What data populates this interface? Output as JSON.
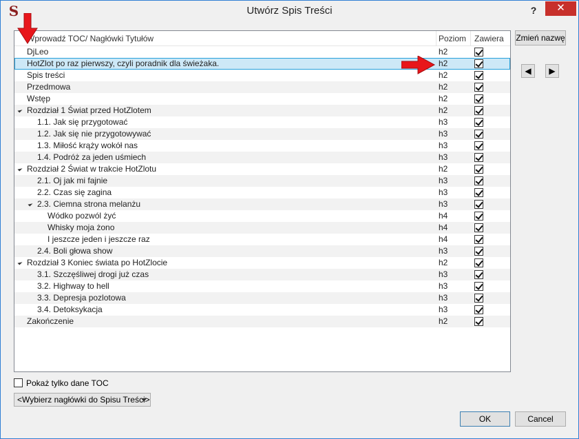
{
  "window": {
    "title": "Utwórz Spis Treści",
    "help_label": "?",
    "close_label": "✕"
  },
  "table": {
    "headers": {
      "title": "Wprowadź TOC/ Nagłówki Tytułów",
      "level": "Poziom",
      "include": "Zawiera"
    },
    "rows": [
      {
        "label": "DjLeo",
        "level": "h2",
        "checked": true,
        "indent": 0,
        "expander": false,
        "selected": false
      },
      {
        "label": "HotZlot po raz pierwszy, czyli poradnik dla świeżaka.",
        "level": "h2",
        "checked": true,
        "indent": 0,
        "expander": false,
        "selected": true
      },
      {
        "label": "Spis treści",
        "level": "h2",
        "checked": true,
        "indent": 0,
        "expander": false,
        "selected": false
      },
      {
        "label": "Przedmowa",
        "level": "h2",
        "checked": true,
        "indent": 0,
        "expander": false,
        "selected": false
      },
      {
        "label": "Wstęp",
        "level": "h2",
        "checked": true,
        "indent": 0,
        "expander": false,
        "selected": false
      },
      {
        "label": "Rozdział 1 Świat przed HotZlotem",
        "level": "h2",
        "checked": true,
        "indent": 0,
        "expander": true,
        "selected": false
      },
      {
        "label": "1.1. Jak się przygotować",
        "level": "h3",
        "checked": true,
        "indent": 1,
        "expander": false,
        "selected": false
      },
      {
        "label": "1.2. Jak się nie przygotowywać",
        "level": "h3",
        "checked": true,
        "indent": 1,
        "expander": false,
        "selected": false
      },
      {
        "label": "1.3. Miłość krąży wokół nas",
        "level": "h3",
        "checked": true,
        "indent": 1,
        "expander": false,
        "selected": false
      },
      {
        "label": "1.4. Podróż za jeden uśmiech",
        "level": "h3",
        "checked": true,
        "indent": 1,
        "expander": false,
        "selected": false
      },
      {
        "label": "Rozdział 2 Świat w trakcie HotZlotu",
        "level": "h2",
        "checked": true,
        "indent": 0,
        "expander": true,
        "selected": false
      },
      {
        "label": "2.1. Oj jak mi fajnie",
        "level": "h3",
        "checked": true,
        "indent": 1,
        "expander": false,
        "selected": false
      },
      {
        "label": "2.2. Czas się zagina",
        "level": "h3",
        "checked": true,
        "indent": 1,
        "expander": false,
        "selected": false
      },
      {
        "label": "2.3. Ciemna strona melanżu",
        "level": "h3",
        "checked": true,
        "indent": 1,
        "expander": true,
        "selected": false
      },
      {
        "label": "Wódko pozwól żyć",
        "level": "h4",
        "checked": true,
        "indent": 2,
        "expander": false,
        "selected": false
      },
      {
        "label": "Whisky moja żono",
        "level": "h4",
        "checked": true,
        "indent": 2,
        "expander": false,
        "selected": false
      },
      {
        "label": "I jeszcze jeden i jeszcze raz",
        "level": "h4",
        "checked": true,
        "indent": 2,
        "expander": false,
        "selected": false
      },
      {
        "label": "2.4. Boli głowa show",
        "level": "h3",
        "checked": true,
        "indent": 1,
        "expander": false,
        "selected": false
      },
      {
        "label": "Rozdział 3 Koniec świata po HotZlocie",
        "level": "h2",
        "checked": true,
        "indent": 0,
        "expander": true,
        "selected": false
      },
      {
        "label": "3.1. Szczęśliwej drogi już czas",
        "level": "h3",
        "checked": true,
        "indent": 1,
        "expander": false,
        "selected": false
      },
      {
        "label": "3.2. Highway to hell",
        "level": "h3",
        "checked": true,
        "indent": 1,
        "expander": false,
        "selected": false
      },
      {
        "label": "3.3. Depresja pozlotowa",
        "level": "h3",
        "checked": true,
        "indent": 1,
        "expander": false,
        "selected": false
      },
      {
        "label": "3.4. Detoksykacja",
        "level": "h3",
        "checked": true,
        "indent": 1,
        "expander": false,
        "selected": false
      },
      {
        "label": "Zakończenie",
        "level": "h2",
        "checked": true,
        "indent": 0,
        "expander": false,
        "selected": false
      }
    ]
  },
  "side": {
    "rename_label": "Zmień nazwę",
    "prev_label": "◀",
    "next_label": "▶"
  },
  "footer": {
    "show_toc_label": "Pokaż tylko dane TOC",
    "show_toc_checked": false,
    "select_value": "<Wybierz nagłówki do Spisu Treści>",
    "ok_label": "OK",
    "cancel_label": "Cancel"
  },
  "colors": {
    "selection": "#cde8f7",
    "selection_border": "#26a0da",
    "annotation_arrow": "#e8161b",
    "close_button": "#c7302b"
  }
}
